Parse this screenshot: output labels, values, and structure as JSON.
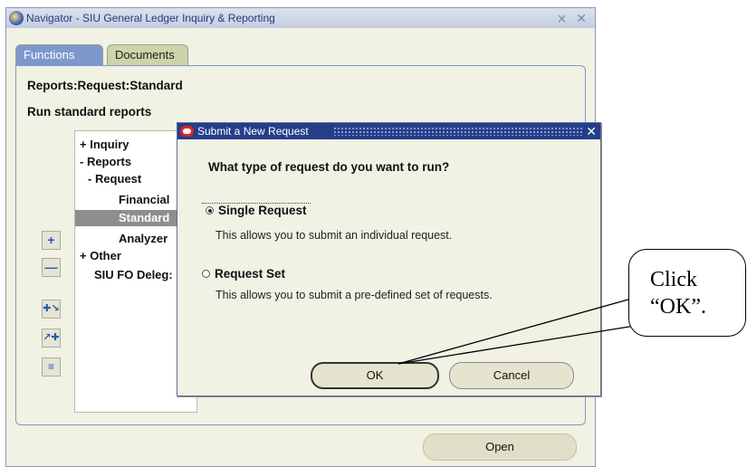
{
  "navigator": {
    "title": "Navigator - SIU General Ledger Inquiry & Reporting",
    "controls": "⨯ ✕",
    "tabs": {
      "functions": "Functions",
      "documents": "Documents"
    },
    "breadcrumb": "Reports:Request:Standard",
    "subtitle": "Run standard reports",
    "tree": [
      {
        "label": "+ Inquiry"
      },
      {
        "label": "- Reports"
      },
      {
        "label": "- Request"
      },
      {
        "label": "Financial"
      },
      {
        "label": "Standard"
      },
      {
        "label": "Analyzer"
      },
      {
        "label": "+ Other"
      },
      {
        "label": "SIU FO Deleg:"
      }
    ],
    "tool_buttons": [
      "expand-icon",
      "collapse-icon",
      "expand-branch-icon",
      "expand-all-icon",
      "collapse-all-icon"
    ],
    "open_label": "Open"
  },
  "dialog": {
    "title": "Submit a New Request",
    "close": "✕",
    "question": "What type of request do you want to run?",
    "options": [
      {
        "label": "Single Request",
        "desc": "This allows you to submit an individual request.",
        "selected": true
      },
      {
        "label": "Request Set",
        "desc": "This allows you to submit a pre-defined set of requests.",
        "selected": false
      }
    ],
    "ok_label": "OK",
    "cancel_label": "Cancel"
  },
  "callout": {
    "line1": "Click",
    "line2": "“OK”."
  },
  "colors": {
    "tab_active": "#7e98cd",
    "tab_inactive": "#cfd3ab",
    "dialog_title": "#243e8a",
    "selection": "#8e8e8e",
    "background": "#f1f1e4"
  }
}
